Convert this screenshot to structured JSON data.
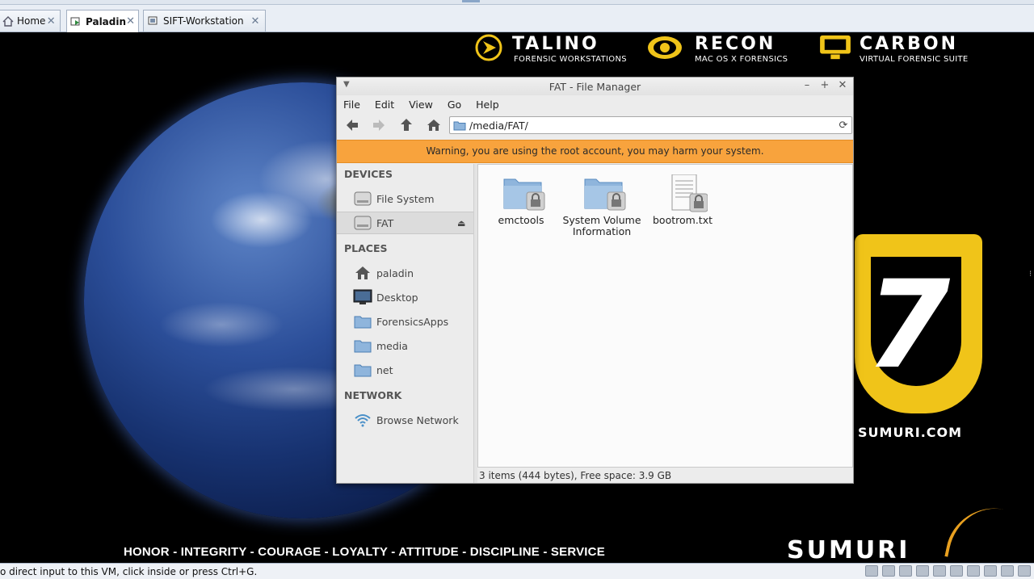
{
  "vm_tabs": [
    {
      "label": "Home"
    },
    {
      "label": "Paladin"
    },
    {
      "label": "SIFT-Workstation"
    }
  ],
  "desktop": {
    "brands": [
      {
        "name": "TALINO",
        "sub": "FORENSIC WORKSTATIONS"
      },
      {
        "name": "RECON",
        "sub": "MAC OS X FORENSICS"
      },
      {
        "name": "CARBON",
        "sub": "VIRTUAL FORENSIC SUITE"
      }
    ],
    "url": "SUMURI.COM",
    "motto": "HONOR - INTEGRITY - COURAGE - LOYALTY - ATTITUDE - DISCIPLINE - SERVICE",
    "logo_text": "SUMURI",
    "colors": {
      "accent": "#f0c419",
      "earth": "#2c4f9a"
    }
  },
  "window": {
    "title": "FAT - File Manager",
    "menu": [
      "File",
      "Edit",
      "View",
      "Go",
      "Help"
    ],
    "path": "/media/FAT/",
    "warning": "Warning, you are using the root account, you may harm your system.",
    "warning_color": "#f8a33d",
    "sidebar": {
      "devices_heading": "DEVICES",
      "devices": [
        {
          "label": "File System",
          "icon": "drive-icon"
        },
        {
          "label": "FAT",
          "icon": "drive-icon",
          "selected": true
        }
      ],
      "places_heading": "PLACES",
      "places": [
        {
          "label": "paladin",
          "icon": "home-icon"
        },
        {
          "label": "Desktop",
          "icon": "desktop-icon"
        },
        {
          "label": "ForensicsApps",
          "icon": "folder-icon"
        },
        {
          "label": "media",
          "icon": "folder-icon"
        },
        {
          "label": "net",
          "icon": "folder-icon"
        }
      ],
      "network_heading": "NETWORK",
      "network": [
        {
          "label": "Browse Network",
          "icon": "wifi-icon"
        }
      ]
    },
    "files": [
      {
        "name": "emctools",
        "type": "folder-locked"
      },
      {
        "name": "System Volume Information",
        "type": "folder-locked"
      },
      {
        "name": "bootrom.txt",
        "type": "text-file-locked"
      }
    ],
    "status": "3 items (444 bytes), Free space: 3.9 GB"
  },
  "vm_status": {
    "message": "o direct input to this VM, click inside or press Ctrl+G."
  }
}
